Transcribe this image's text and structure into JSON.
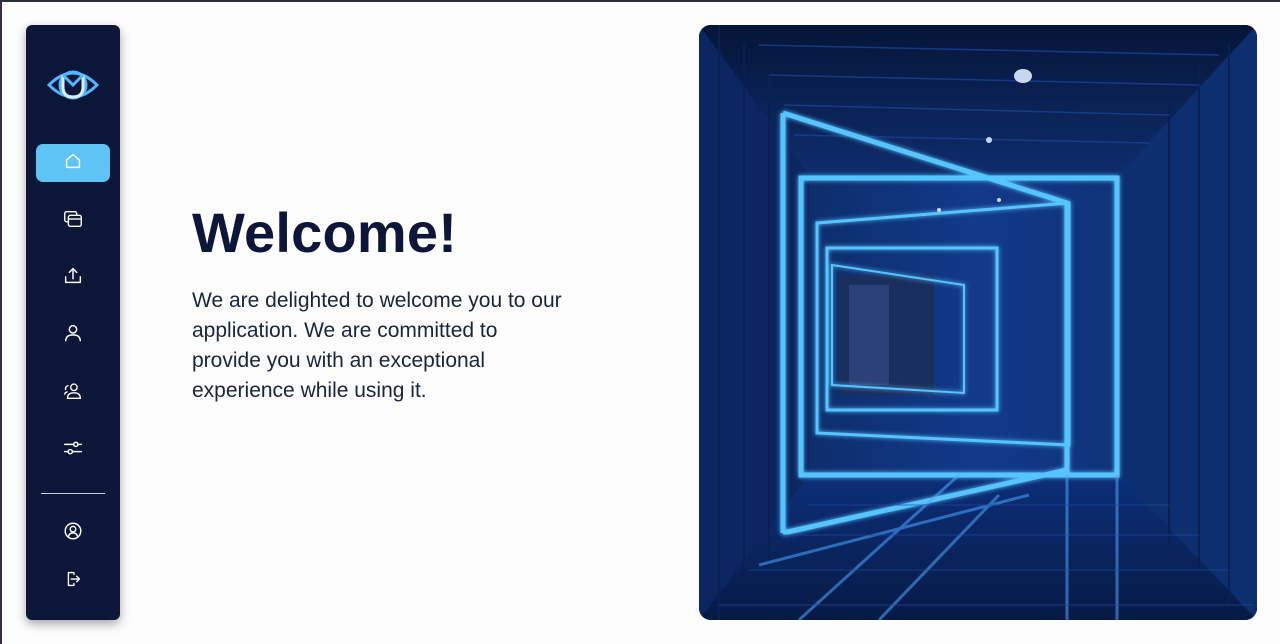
{
  "sidebar": {
    "logo": {
      "icon": "eye-logo-icon"
    },
    "nav": [
      {
        "id": "home",
        "icon": "home-icon",
        "active": true
      },
      {
        "id": "gallery",
        "icon": "cards-icon",
        "active": false
      },
      {
        "id": "upload",
        "icon": "upload-icon",
        "active": false
      },
      {
        "id": "profile",
        "icon": "user-icon",
        "active": false
      },
      {
        "id": "users",
        "icon": "users-icon",
        "active": false
      },
      {
        "id": "settings",
        "icon": "sliders-icon",
        "active": false
      }
    ],
    "bottom": [
      {
        "id": "account",
        "icon": "user-circle-icon"
      },
      {
        "id": "logout",
        "icon": "logout-icon"
      }
    ]
  },
  "main": {
    "title": "Welcome!",
    "description": "We are delighted to welcome you to our application. We are committed to provide you with an exceptional experience while using it."
  },
  "hero": {
    "image": "neon-corridor-image"
  },
  "colors": {
    "sidebar_bg": "#0b1638",
    "active_accent": "#5ec4f5",
    "title": "#0b1638",
    "neon": "#4fb8ff"
  }
}
